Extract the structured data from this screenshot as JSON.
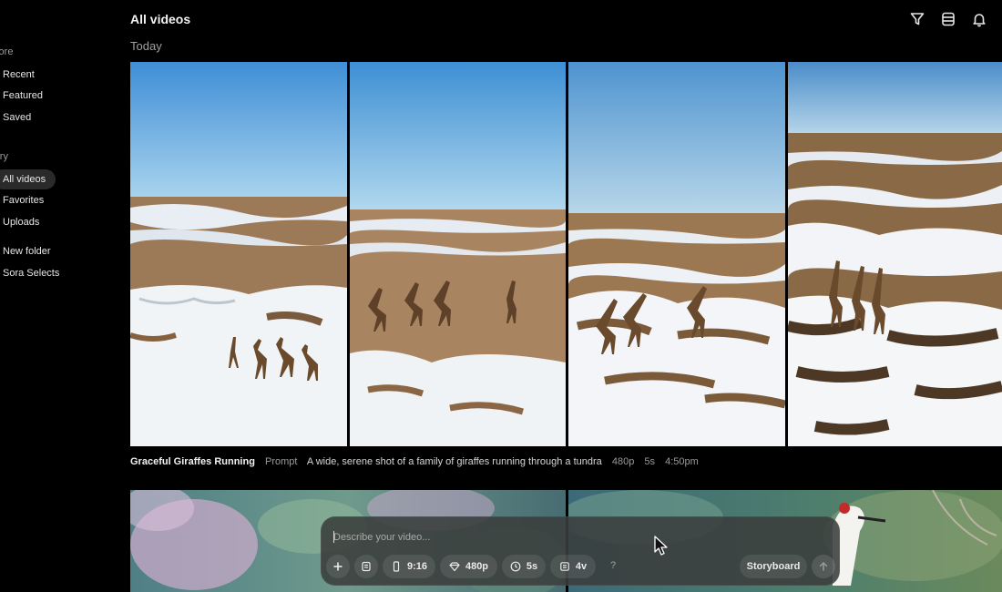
{
  "sidebar": {
    "sections": [
      {
        "label": "plore",
        "items": [
          "Recent",
          "Featured",
          "Saved"
        ]
      },
      {
        "label": "rary",
        "items": [
          "All videos",
          "Favorites",
          "Uploads"
        ]
      },
      {
        "label": "",
        "items": [
          "New folder",
          "Sora Selects"
        ]
      }
    ],
    "active_item": "All videos"
  },
  "header": {
    "title": "All videos",
    "icons": [
      "filter-icon",
      "list-view-icon",
      "bell-icon"
    ]
  },
  "date_group": "Today",
  "videos": [
    {
      "title": "Graceful Giraffes Running",
      "prompt_label": "Prompt",
      "prompt": "A wide, serene shot of a family of giraffes running through a tundra",
      "resolution": "480p",
      "duration": "5s",
      "time": "4:50pm",
      "thumbnails": 4
    }
  ],
  "composer": {
    "placeholder": "Describe your video...",
    "add_icon": "plus-icon",
    "preset_icon": "document-icon",
    "aspect_ratio": "9:16",
    "resolution": "480p",
    "duration": "5s",
    "variations": "4v",
    "help": "?",
    "storyboard_label": "Storyboard",
    "send_icon": "arrow-up-icon"
  },
  "colors": {
    "background": "#000000",
    "composer": "#3a3e3c",
    "chip": "#4a4d4b",
    "active_nav": "#2a2a2a"
  }
}
